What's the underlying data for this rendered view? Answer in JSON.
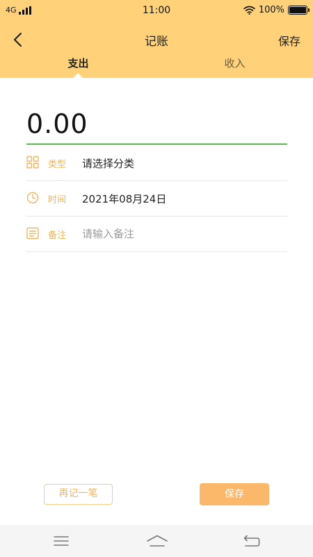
{
  "status_bar": {
    "network": "4G",
    "time": "11:00",
    "battery": "100%"
  },
  "nav": {
    "title": "记账",
    "save_label": "保存"
  },
  "tabs": [
    {
      "label": "支出",
      "selected": true
    },
    {
      "label": "收入",
      "selected": false
    }
  ],
  "amount": "0.00",
  "form": {
    "category": {
      "label": "类型",
      "value": "请选择分类"
    },
    "time": {
      "label": "时间",
      "value": "2021年08月24日"
    },
    "note": {
      "label": "备注",
      "placeholder": "请输入备注",
      "value": ""
    }
  },
  "buttons": {
    "again_label": "再记一笔",
    "save_label": "保存"
  },
  "icons": {
    "back": "chevron-left-icon",
    "wifi": "wifi-icon",
    "battery": "battery-icon",
    "signal": "signal-icon",
    "category": "grid-icon",
    "time": "clock-icon",
    "note": "note-icon",
    "menu": "menu-icon",
    "home": "home-icon",
    "return": "return-icon"
  },
  "colors": {
    "header_bg": "#ffd27a",
    "accent": "#f2b35b",
    "amount_underline": "#59b94c",
    "save_button_bg": "#fbb86a",
    "again_button_border": "#f7cb86"
  }
}
